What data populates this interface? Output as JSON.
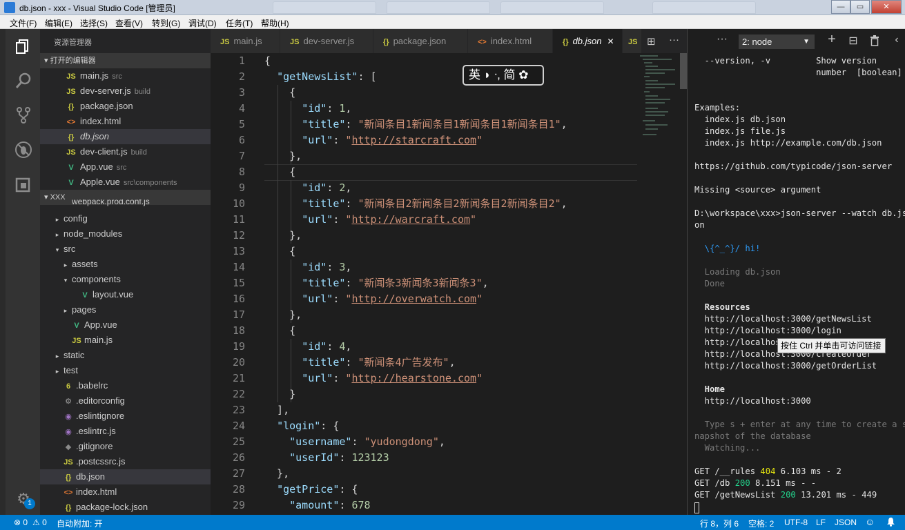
{
  "window": {
    "title": "db.json - xxx - Visual Studio Code [管理员]",
    "controls": {
      "minimize": "—",
      "maximize": "▭",
      "close": "✕"
    }
  },
  "menu": [
    {
      "label": "文件(F)"
    },
    {
      "label": "编辑(E)"
    },
    {
      "label": "选择(S)"
    },
    {
      "label": "查看(V)"
    },
    {
      "label": "转到(G)"
    },
    {
      "label": "调试(D)"
    },
    {
      "label": "任务(T)"
    },
    {
      "label": "帮助(H)"
    }
  ],
  "activity_icons": [
    "explorer-icon",
    "search-icon",
    "source-control-icon",
    "debug-icon",
    "extensions-icon",
    "settings-gear-icon"
  ],
  "settings_badge": "1",
  "sidebar": {
    "title": "资源管理器",
    "open_editors_header": "▾ 打开的编辑器",
    "open_editors": [
      {
        "icon": "JS",
        "name": "main.js",
        "hint": "src"
      },
      {
        "icon": "JS",
        "name": "dev-server.js",
        "hint": "build"
      },
      {
        "icon": "{}",
        "name": "package.json",
        "hint": ""
      },
      {
        "icon": "<>",
        "name": "index.html",
        "hint": ""
      },
      {
        "icon": "{}",
        "name": "db.json",
        "hint": ""
      },
      {
        "icon": "JS",
        "name": "dev-client.js",
        "hint": "build"
      },
      {
        "icon": "V",
        "name": "App.vue",
        "hint": "src"
      },
      {
        "icon": "V",
        "name": "Apple.vue",
        "hint": "src\\components"
      }
    ],
    "project_header": "▾ XXX",
    "tree_partial": "webpack.prod.conf.js",
    "tree": [
      {
        "twisty": "▸",
        "icon": "",
        "name": "config"
      },
      {
        "twisty": "▸",
        "icon": "",
        "name": "node_modules"
      },
      {
        "twisty": "▾",
        "icon": "",
        "name": "src"
      },
      {
        "twisty": "▸",
        "icon": "",
        "name": "assets"
      },
      {
        "twisty": "▾",
        "icon": "",
        "name": "components"
      },
      {
        "twisty": "",
        "icon": "V",
        "name": "layout.vue"
      },
      {
        "twisty": "▸",
        "icon": "",
        "name": "pages"
      },
      {
        "twisty": "",
        "icon": "V",
        "name": "App.vue"
      },
      {
        "twisty": "",
        "icon": "JS",
        "name": "main.js"
      },
      {
        "twisty": "▸",
        "icon": "",
        "name": "static"
      },
      {
        "twisty": "▸",
        "icon": "",
        "name": "test"
      },
      {
        "twisty": "",
        "icon": "6",
        "name": ".babelrc"
      },
      {
        "twisty": "",
        "icon": "⚙",
        "name": ".editorconfig"
      },
      {
        "twisty": "",
        "icon": "◉",
        "name": ".eslintignore"
      },
      {
        "twisty": "",
        "icon": "◉",
        "name": ".eslintrc.js"
      },
      {
        "twisty": "",
        "icon": "◆",
        "name": ".gitignore"
      },
      {
        "twisty": "",
        "icon": "JS",
        "name": ".postcssrc.js"
      },
      {
        "twisty": "",
        "icon": "{}",
        "name": "db.json"
      },
      {
        "twisty": "",
        "icon": "<>",
        "name": "index.html"
      },
      {
        "twisty": "",
        "icon": "{}",
        "name": "package-lock.json"
      }
    ]
  },
  "tabs": [
    {
      "icon": "JS",
      "label": "main.js"
    },
    {
      "icon": "JS",
      "label": "dev-server.js"
    },
    {
      "icon": "{}",
      "label": "package.json"
    },
    {
      "icon": "<>",
      "label": "index.html"
    },
    {
      "icon": "{}",
      "label": "db.json",
      "close": "✕"
    },
    {
      "icon": "JS",
      "label": ""
    }
  ],
  "ime_toolbar": "英 ◗ ᐧ, 简 ✿",
  "editor": {
    "line_numbers": [
      "1",
      "2",
      "3",
      "4",
      "5",
      "6",
      "7",
      "8",
      "9",
      "10",
      "11",
      "12",
      "13",
      "14",
      "15",
      "16",
      "17",
      "18",
      "19",
      "20",
      "21",
      "22",
      "23",
      "24",
      "25",
      "26",
      "27",
      "28",
      "29"
    ],
    "lines": [
      [
        [
          "p",
          "{"
        ]
      ],
      [
        [
          "p",
          "  "
        ],
        [
          "k",
          "\"getNewsList\""
        ],
        [
          "p",
          ": ["
        ]
      ],
      [
        [
          "p",
          "    {"
        ]
      ],
      [
        [
          "p",
          "      "
        ],
        [
          "k",
          "\"id\""
        ],
        [
          "p",
          ": "
        ],
        [
          "n",
          "1"
        ],
        [
          "p",
          ","
        ]
      ],
      [
        [
          "p",
          "      "
        ],
        [
          "k",
          "\"title\""
        ],
        [
          "p",
          ": "
        ],
        [
          "s",
          "\"新闻条目1新闻条目1新闻条目1新闻条目1\""
        ],
        [
          "p",
          ","
        ]
      ],
      [
        [
          "p",
          "      "
        ],
        [
          "k",
          "\"url\""
        ],
        [
          "p",
          ": "
        ],
        [
          "s",
          "\""
        ],
        [
          "u",
          "http://starcraft.com"
        ],
        [
          "s",
          "\""
        ]
      ],
      [
        [
          "p",
          "    },"
        ]
      ],
      [
        [
          "p",
          "    {"
        ]
      ],
      [
        [
          "p",
          "      "
        ],
        [
          "k",
          "\"id\""
        ],
        [
          "p",
          ": "
        ],
        [
          "n",
          "2"
        ],
        [
          "p",
          ","
        ]
      ],
      [
        [
          "p",
          "      "
        ],
        [
          "k",
          "\"title\""
        ],
        [
          "p",
          ": "
        ],
        [
          "s",
          "\"新闻条目2新闻条目2新闻条目2新闻条目2\""
        ],
        [
          "p",
          ","
        ]
      ],
      [
        [
          "p",
          "      "
        ],
        [
          "k",
          "\"url\""
        ],
        [
          "p",
          ": "
        ],
        [
          "s",
          "\""
        ],
        [
          "u",
          "http://warcraft.com"
        ],
        [
          "s",
          "\""
        ]
      ],
      [
        [
          "p",
          "    },"
        ]
      ],
      [
        [
          "p",
          "    {"
        ]
      ],
      [
        [
          "p",
          "      "
        ],
        [
          "k",
          "\"id\""
        ],
        [
          "p",
          ": "
        ],
        [
          "n",
          "3"
        ],
        [
          "p",
          ","
        ]
      ],
      [
        [
          "p",
          "      "
        ],
        [
          "k",
          "\"title\""
        ],
        [
          "p",
          ": "
        ],
        [
          "s",
          "\"新闻条3新闻条3新闻条3\""
        ],
        [
          "p",
          ","
        ]
      ],
      [
        [
          "p",
          "      "
        ],
        [
          "k",
          "\"url\""
        ],
        [
          "p",
          ": "
        ],
        [
          "s",
          "\""
        ],
        [
          "u",
          "http://overwatch.com"
        ],
        [
          "s",
          "\""
        ]
      ],
      [
        [
          "p",
          "    },"
        ]
      ],
      [
        [
          "p",
          "    {"
        ]
      ],
      [
        [
          "p",
          "      "
        ],
        [
          "k",
          "\"id\""
        ],
        [
          "p",
          ": "
        ],
        [
          "n",
          "4"
        ],
        [
          "p",
          ","
        ]
      ],
      [
        [
          "p",
          "      "
        ],
        [
          "k",
          "\"title\""
        ],
        [
          "p",
          ": "
        ],
        [
          "s",
          "\"新闻条4广告发布\""
        ],
        [
          "p",
          ","
        ]
      ],
      [
        [
          "p",
          "      "
        ],
        [
          "k",
          "\"url\""
        ],
        [
          "p",
          ": "
        ],
        [
          "s",
          "\""
        ],
        [
          "u",
          "http://hearstone.com"
        ],
        [
          "s",
          "\""
        ]
      ],
      [
        [
          "p",
          "    }"
        ]
      ],
      [
        [
          "p",
          "  ],"
        ]
      ],
      [
        [
          "p",
          "  "
        ],
        [
          "k",
          "\"login\""
        ],
        [
          "p",
          ": {"
        ]
      ],
      [
        [
          "p",
          "    "
        ],
        [
          "k",
          "\"username\""
        ],
        [
          "p",
          ": "
        ],
        [
          "s",
          "\"yudongdong\""
        ],
        [
          "p",
          ","
        ]
      ],
      [
        [
          "p",
          "    "
        ],
        [
          "k",
          "\"userId\""
        ],
        [
          "p",
          ": "
        ],
        [
          "n",
          "123123"
        ]
      ],
      [
        [
          "p",
          "  },"
        ]
      ],
      [
        [
          "p",
          "  "
        ],
        [
          "k",
          "\"getPrice\""
        ],
        [
          "p",
          ": {"
        ]
      ],
      [
        [
          "p",
          "    "
        ],
        [
          "k",
          "\"amount\""
        ],
        [
          "p",
          ": "
        ],
        [
          "n",
          "678"
        ]
      ]
    ]
  },
  "panel": {
    "more": "···",
    "terminal_select": "2: node",
    "icons": {
      "add": "+",
      "split": "⊟",
      "trash": "🗑",
      "collapse": "‹"
    }
  },
  "terminal": [
    {
      "t": "  --version, -v         Show version",
      "c": ""
    },
    {
      "t": "                        number  [boolean]",
      "c": ""
    },
    {
      "t": "",
      "c": ""
    },
    {
      "t": "",
      "c": ""
    },
    {
      "t": "Examples:",
      "c": ""
    },
    {
      "t": "  index.js db.json",
      "c": ""
    },
    {
      "t": "  index.js file.js",
      "c": ""
    },
    {
      "t": "  index.js http://example.com/db.json",
      "c": ""
    },
    {
      "t": "",
      "c": ""
    },
    {
      "t": "https://github.com/typicode/json-server",
      "c": ""
    },
    {
      "t": "",
      "c": ""
    },
    {
      "t": "Missing <source> argument",
      "c": ""
    },
    {
      "t": "",
      "c": ""
    },
    {
      "t": "D:\\workspace\\xxx>json-server --watch db.js",
      "c": ""
    },
    {
      "t": "on",
      "c": ""
    },
    {
      "t": "",
      "c": ""
    },
    {
      "t": "  \\{^_^}/ hi!",
      "c": "tblu"
    },
    {
      "t": "",
      "c": ""
    },
    {
      "t": "  Loading db.json",
      "c": "tdim"
    },
    {
      "t": "  Done",
      "c": "tdim"
    },
    {
      "t": "",
      "c": ""
    },
    {
      "t": "  Resources",
      "c": "tbold"
    },
    {
      "t": "  http://localhost:3000/getNewsList",
      "c": ""
    },
    {
      "t": "  http://localhost:3000/login",
      "c": ""
    },
    {
      "t": "  http://localhost:3000/getPrice",
      "c": ""
    },
    {
      "t": "  http://localhost:3000/createOrder",
      "c": ""
    },
    {
      "t": "  http://localhost:3000/getOrderList",
      "c": ""
    },
    {
      "t": "",
      "c": ""
    },
    {
      "t": "  Home",
      "c": "tbold"
    },
    {
      "t": "  http://localhost:3000",
      "c": ""
    },
    {
      "t": "",
      "c": ""
    },
    {
      "t": "  Type s + enter at any time to create a s",
      "c": "tdim"
    },
    {
      "t": "napshot of the database",
      "c": "tdim"
    },
    {
      "t": "  Watching...",
      "c": "tdim"
    },
    {
      "t": "",
      "c": ""
    },
    {
      "t": "GET /__rules 404 6.103 ms - 2",
      "c": "",
      "code": "404"
    },
    {
      "t": "GET /db 200 8.151 ms - -",
      "c": "",
      "code": "200"
    },
    {
      "t": "GET /getNewsList 200 13.201 ms - 449",
      "c": "",
      "code": "200"
    }
  ],
  "tooltip": "按住 Ctrl 并单击可访问链接",
  "statusbar": {
    "errors": "⊗ 0",
    "warnings": "⚠ 0",
    "auto_attach": "自动附加: 开",
    "position": "行 8，列 6",
    "spaces": "空格: 2",
    "encoding": "UTF-8",
    "eol": "LF",
    "language": "JSON",
    "feedback": "☺",
    "notifications": "🔔"
  },
  "colors": {
    "accent": "#007acc",
    "string": "#ce9178",
    "key": "#9cdcfe",
    "number": "#b5cea8"
  }
}
